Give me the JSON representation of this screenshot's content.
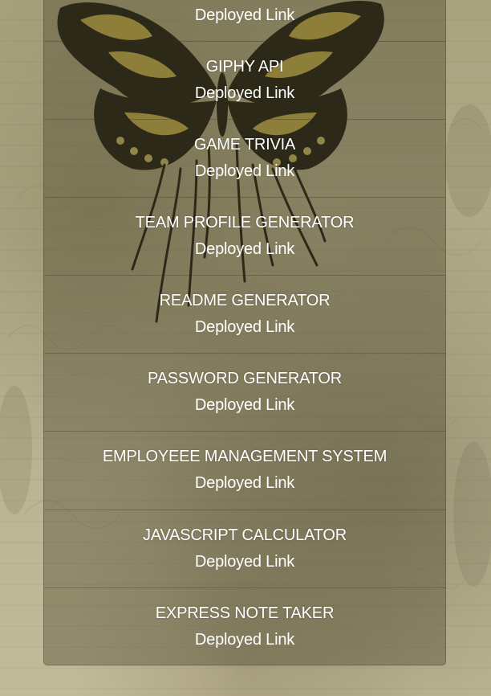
{
  "projects": [
    {
      "title": "",
      "link_label": "Deployed Link"
    },
    {
      "title": "GIPHY API",
      "link_label": "Deployed Link"
    },
    {
      "title": "GAME TRIVIA",
      "link_label": "Deployed Link"
    },
    {
      "title": "TEAM PROFILE GENERATOR",
      "link_label": "Deployed Link"
    },
    {
      "title": "README GENERATOR",
      "link_label": "Deployed Link"
    },
    {
      "title": "PASSWORD GENERATOR",
      "link_label": "Deployed Link"
    },
    {
      "title": "EMPLOYEEE MANAGEMENT SYSTEM",
      "link_label": "Deployed Link"
    },
    {
      "title": "JAVASCRIPT CALCULATOR",
      "link_label": "Deployed Link"
    },
    {
      "title": "EXPRESS NOTE TAKER",
      "link_label": "Deployed Link"
    }
  ],
  "colors": {
    "text": "#ffffff",
    "panel": "#46422880",
    "background": "#b3ab88",
    "butterfly_dark": "#1e1a10",
    "butterfly_yellow": "#c9b44a"
  },
  "icons": {
    "background_art": "butterfly-icon"
  }
}
